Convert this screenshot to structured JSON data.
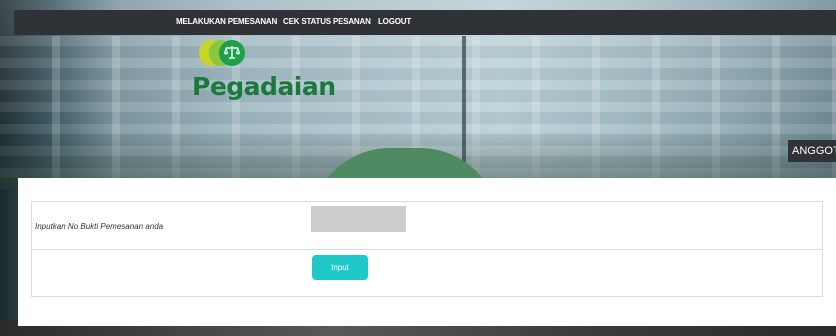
{
  "nav": {
    "items": [
      {
        "label": "MELAKUKAN PEMESANAN"
      },
      {
        "label": "CEK STATUS PESANAN"
      },
      {
        "label": "LOGOUT"
      }
    ]
  },
  "brand": {
    "name": "Pegadaian",
    "icon": "scale-icon",
    "colors": {
      "lime": "#c7d52a",
      "light_green": "#8cc63e",
      "green": "#1ea04b",
      "text": "#1a7a3e"
    }
  },
  "member_tag": {
    "label": "ANGGOTA"
  },
  "form": {
    "label": "Inputkan No Bukti Pemesanan anda",
    "input_value": "",
    "input_placeholder": "",
    "submit_label": "Input",
    "submit_color": "#1fc8c9"
  }
}
